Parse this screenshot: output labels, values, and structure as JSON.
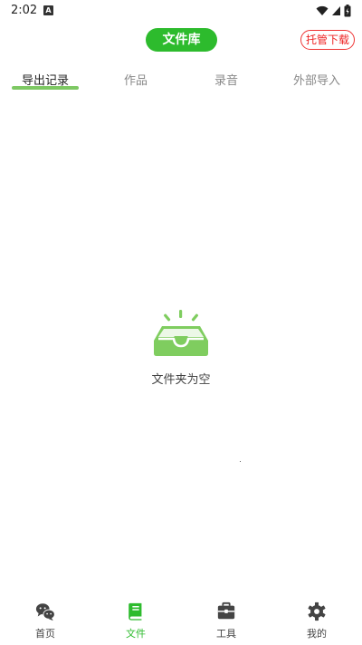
{
  "status_bar": {
    "time": "2:02",
    "notification_icon": "A"
  },
  "header": {
    "title": "文件库",
    "hosted_download_label": "托管下载"
  },
  "tabs": [
    {
      "label": "导出记录",
      "active": true
    },
    {
      "label": "作品",
      "active": false
    },
    {
      "label": "录音",
      "active": false
    },
    {
      "label": "外部导入",
      "active": false
    }
  ],
  "empty_state": {
    "icon": "empty-inbox-icon",
    "message": "文件夹为空"
  },
  "bottom_nav": [
    {
      "label": "首页",
      "icon": "wechat-icon",
      "active": false
    },
    {
      "label": "文件",
      "icon": "book-icon",
      "active": true
    },
    {
      "label": "工具",
      "icon": "toolbox-icon",
      "active": false
    },
    {
      "label": "我的",
      "icon": "gear-icon",
      "active": false
    }
  ],
  "colors": {
    "accent": "#2dbb2d",
    "tab_indicator": "#7dc863",
    "hosted_red": "#e22222",
    "empty_icon": "#7fcd5f"
  }
}
